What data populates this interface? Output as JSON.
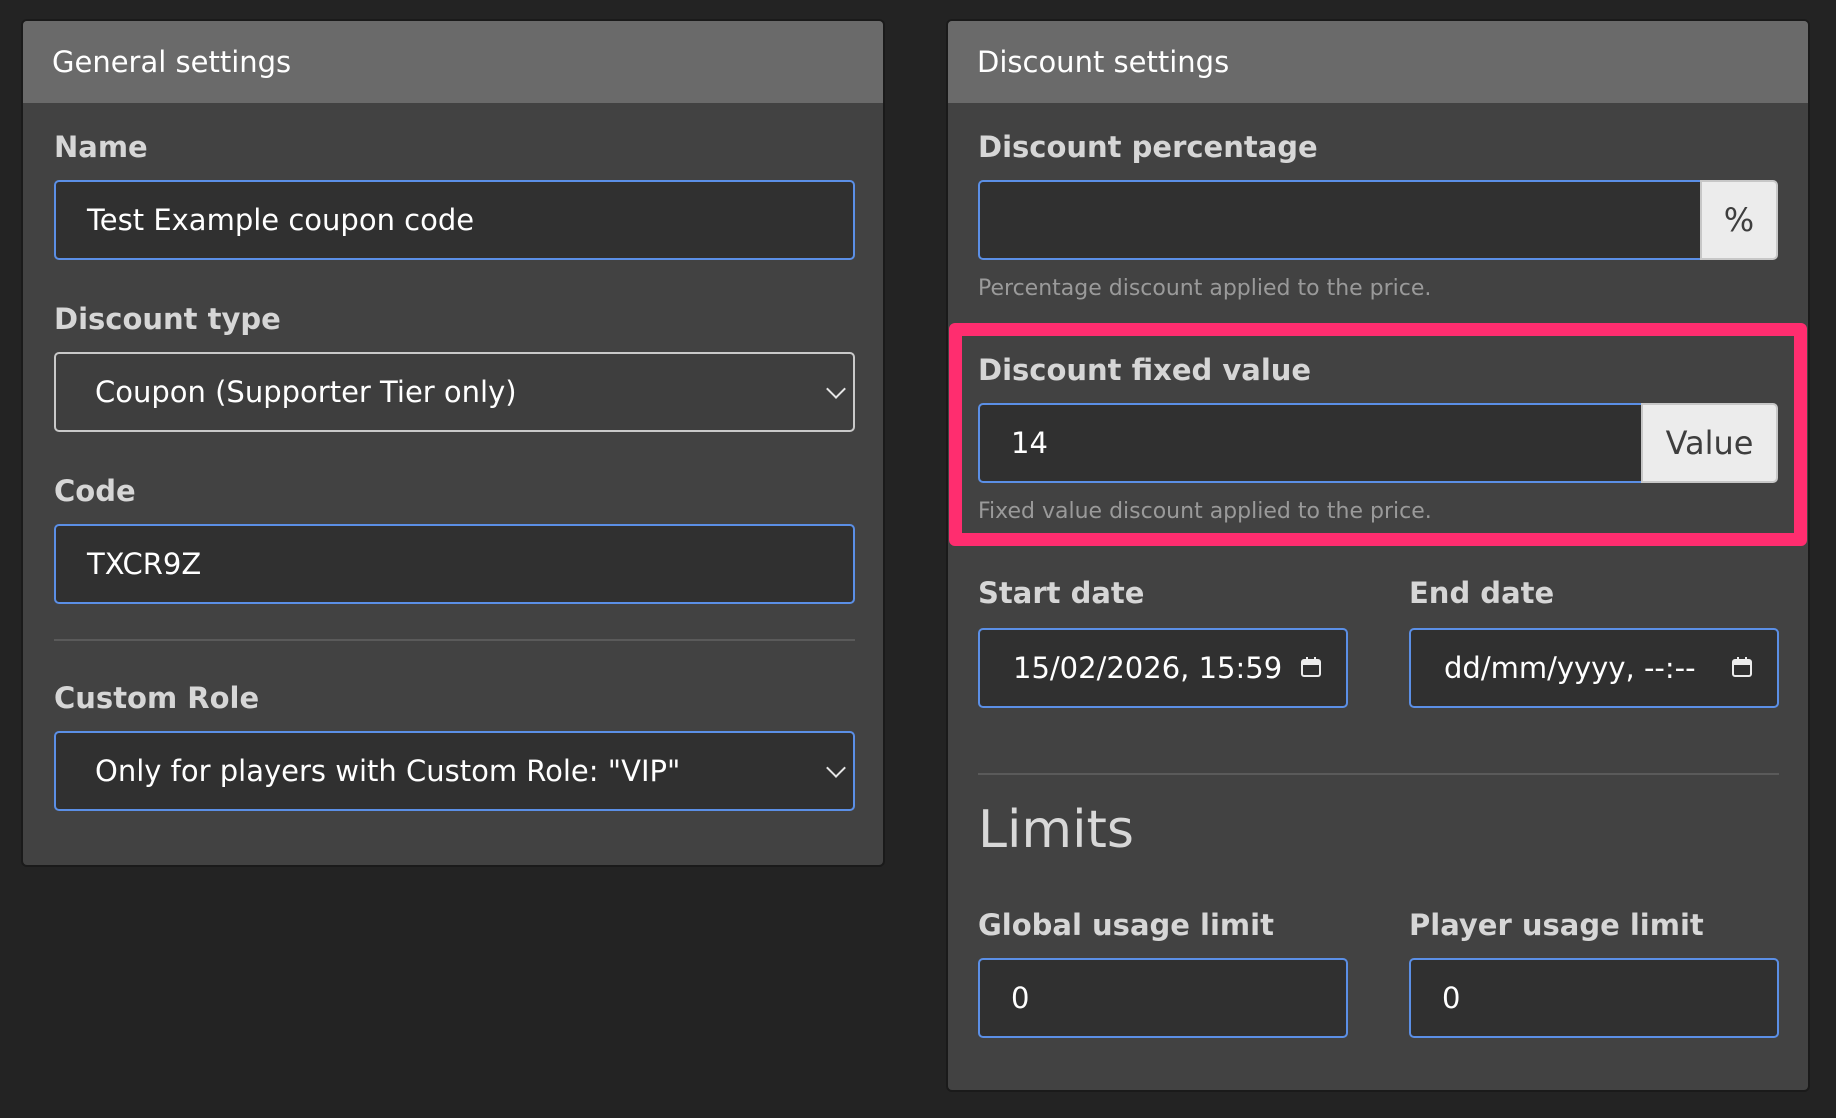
{
  "general": {
    "header": "General settings",
    "name_label": "Name",
    "name_value": "Test Example coupon code",
    "discount_type_label": "Discount type",
    "discount_type_value": "Coupon (Supporter Tier only)",
    "code_label": "Code",
    "code_value": "TXCR9Z",
    "custom_role_label": "Custom Role",
    "custom_role_value": "Only for players with Custom Role: \"VIP\""
  },
  "discount": {
    "header": "Discount settings",
    "percentage_label": "Discount percentage",
    "percentage_value": "",
    "percentage_addon": "%",
    "percentage_help": "Percentage discount applied to the price.",
    "fixed_label": "Discount fixed value",
    "fixed_value": "14",
    "fixed_addon": "Value",
    "fixed_help": "Fixed value discount applied to the price.",
    "start_label": "Start date",
    "start_value": "15/02/2026, 15:59",
    "end_label": "End date",
    "end_value": "dd/mm/yyyy, --:--"
  },
  "limits": {
    "title": "Limits",
    "global_label": "Global usage limit",
    "global_value": "0",
    "player_label": "Player usage limit",
    "player_value": "0"
  },
  "icons": {
    "chevron": "chevron-down-icon",
    "calendar": "calendar-icon"
  },
  "colors": {
    "highlight": "#ff2d6f",
    "input_border": "#5b8fe6"
  }
}
